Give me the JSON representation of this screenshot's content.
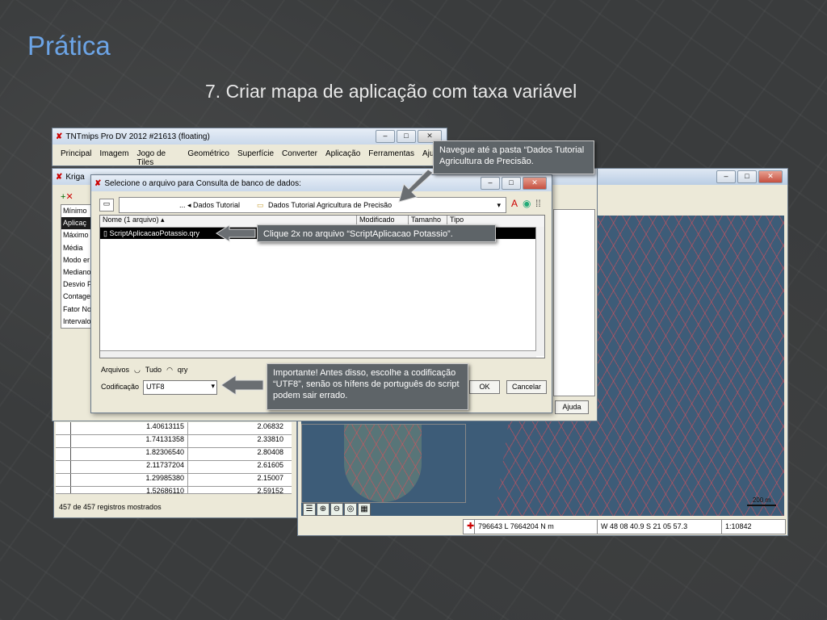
{
  "slide": {
    "title": "Prática",
    "subtitle": "7. Criar mapa de aplicação com taxa variável"
  },
  "main_window": {
    "title": "TNTmips Pro DV 2012  #21613 (floating)",
    "menu": [
      "Principal",
      "Imagem",
      "Jogo de Tiles",
      "Geométrico",
      "Superfície",
      "Converter",
      "Aplicação",
      "Ferramentas",
      "Ajud"
    ]
  },
  "krig_window": {
    "title": "Kriga",
    "fields": [
      "Mínimo",
      "Aplicaç",
      "Máximo",
      "Média",
      "Modo er",
      "Mediano",
      "Desvio P",
      "Contage",
      "Fator No",
      "Intervalo"
    ],
    "ajuda_label": "Ajuda"
  },
  "file_dialog": {
    "title": "Selecione o arquivo para Consulta de banco de dados:",
    "path_parent": "... ◂ Dados Tutorial",
    "path_current": "Dados Tutorial Agricultura de Precisão",
    "columns": [
      "Nome  (1 arquivo) ▴",
      "Modificado",
      "Tamanho",
      "Tipo"
    ],
    "files": [
      "ScriptAplicacaoPotassio.qry"
    ],
    "arquivos_label": "Arquivos",
    "filter_tudo": "Tudo",
    "filter_qry": "qry",
    "codificacao_label": "Codificação",
    "codificacao_value": "UTF8",
    "ok_label": "OK",
    "cancel_label": "Cancelar"
  },
  "table": {
    "rows": [
      [
        "1.40613115",
        "2.06832"
      ],
      [
        "1.74131358",
        "2.33810"
      ],
      [
        "1.82306540",
        "2.80408"
      ],
      [
        "2.11737204",
        "2.61605"
      ],
      [
        "1.29985380",
        "2.15007"
      ],
      [
        "1.52686110",
        "2.59152"
      ]
    ],
    "status": "457 de 457 registros mostrados"
  },
  "map_window": {
    "scale_label": "200 m",
    "coords": "796643 L  7664204 N m",
    "latlon": "W 48 08 40.9  S 21 05 57.3",
    "scale_ratio": "1:10842"
  },
  "callouts": {
    "navigate": "Navegue até a pasta “Dados Tutorial Agricultura de Precisão.",
    "doubleclick": "Clique 2x no arquivo “ScriptAplicacao Potassio”.",
    "important": "Importante! Antes disso, escolhe a codificação “UTF8”, senão os hífens de português do script podem sair errado."
  },
  "colors": {
    "slide_title": "#6ca4e6",
    "map_bg": "#3d5c78",
    "grid_line": "#dc505a"
  }
}
